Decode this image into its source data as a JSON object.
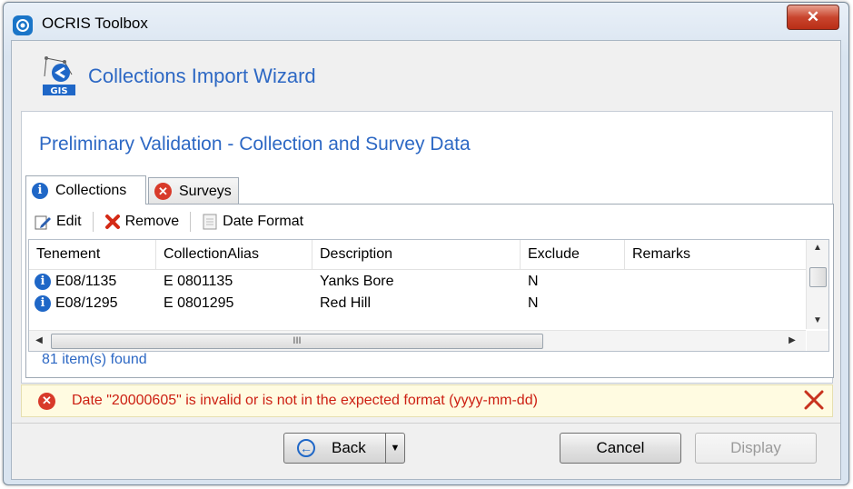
{
  "window": {
    "title": "OCRIS Toolbox",
    "close_glyph": "✕"
  },
  "wizard": {
    "title": "Collections Import Wizard",
    "logo_text": "GIS"
  },
  "section": {
    "title": "Preliminary Validation - Collection and Survey Data"
  },
  "tabs": [
    {
      "label": "Collections",
      "icon": "info-icon",
      "active": true
    },
    {
      "label": "Surveys",
      "icon": "error-icon",
      "active": false
    }
  ],
  "toolbar": {
    "edit": "Edit",
    "remove": "Remove",
    "date_format": "Date Format"
  },
  "grid": {
    "columns": [
      "Tenement",
      "CollectionAlias",
      "Description",
      "Exclude",
      "Remarks"
    ],
    "rows": [
      {
        "tenement": "E08/1135",
        "alias": "E  0801135",
        "description": "Yanks Bore",
        "exclude": "N",
        "remarks": ""
      },
      {
        "tenement": "E08/1295",
        "alias": "E  0801295",
        "description": "Red Hill",
        "exclude": "N",
        "remarks": ""
      }
    ],
    "hscroll_grip": "III"
  },
  "status": {
    "count": "81 item(s) found"
  },
  "error": {
    "message": "Date \"20000605\" is invalid or is not in the expected format (yyyy-mm-dd)",
    "icon": "error-icon"
  },
  "buttons": {
    "back": "Back",
    "cancel": "Cancel",
    "display": "Display"
  },
  "colors": {
    "accent": "#2d68c4",
    "error": "#cc1f12",
    "info": "#1f67c7"
  }
}
